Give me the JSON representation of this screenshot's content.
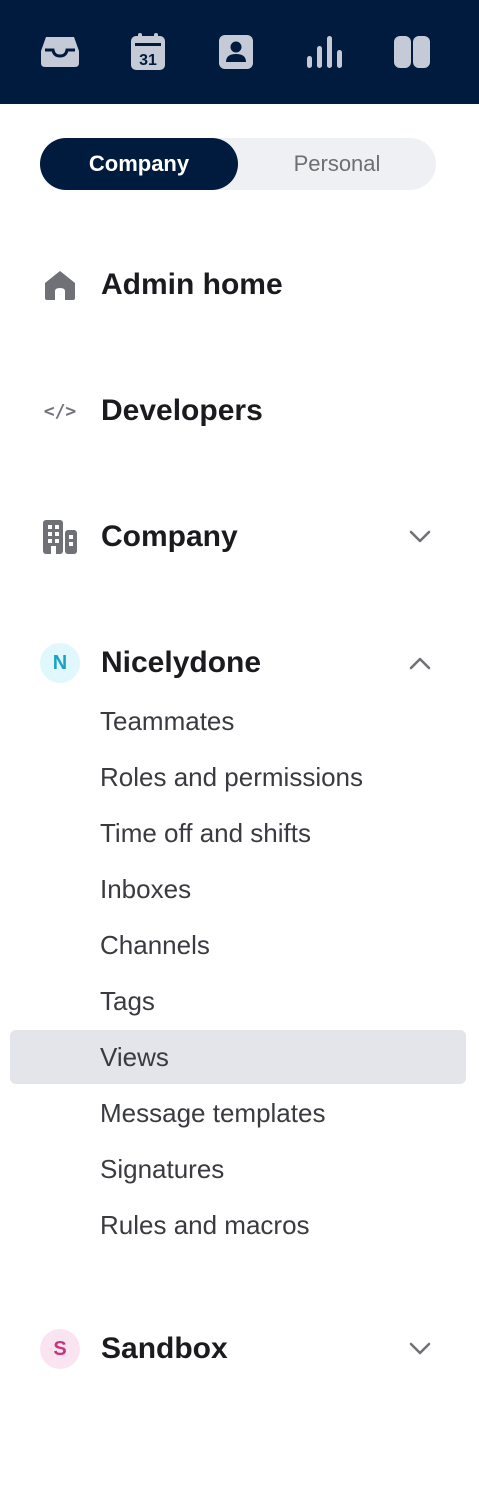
{
  "topbar": {
    "icons": [
      {
        "name": "inbox-icon"
      },
      {
        "name": "calendar-icon",
        "text": "31"
      },
      {
        "name": "contacts-icon"
      },
      {
        "name": "analytics-icon"
      },
      {
        "name": "panels-icon"
      }
    ]
  },
  "scope_toggle": {
    "options": [
      "Company",
      "Personal"
    ],
    "selected": "Company"
  },
  "nav": {
    "admin_home": {
      "label": "Admin home",
      "icon": "home-icon"
    },
    "developers": {
      "label": "Developers",
      "icon": "code-icon",
      "icon_text": "</>"
    },
    "company": {
      "label": "Company",
      "icon": "building-icon",
      "expanded": false
    },
    "nicelydone": {
      "label": "Nicelydone",
      "badge": "N",
      "badge_color": "#1ba3c6",
      "badge_bg": "#e0f7fb",
      "expanded": true,
      "items": [
        {
          "label": "Teammates"
        },
        {
          "label": "Roles and permissions"
        },
        {
          "label": "Time off and shifts"
        },
        {
          "label": "Inboxes"
        },
        {
          "label": "Channels"
        },
        {
          "label": "Tags"
        },
        {
          "label": "Views",
          "selected": true
        },
        {
          "label": "Message templates"
        },
        {
          "label": "Signatures"
        },
        {
          "label": "Rules and macros"
        }
      ]
    },
    "sandbox": {
      "label": "Sandbox",
      "badge": "S",
      "badge_color": "#c2387f",
      "badge_bg": "#fbe4f1",
      "expanded": false
    }
  },
  "colors": {
    "topbar_bg": "#001b3d",
    "topbar_icon": "#c5cbd6",
    "selected_row": "#e3e5ea"
  }
}
